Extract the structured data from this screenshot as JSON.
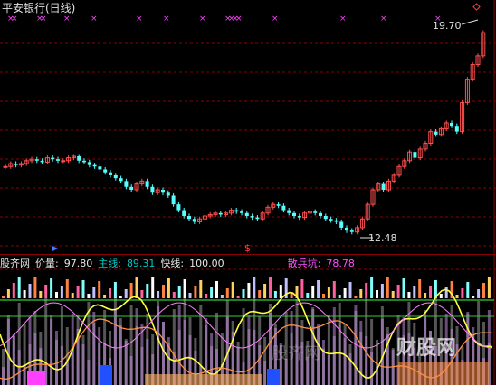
{
  "chart_title": "平安银行(日线)",
  "price_high_label": "19.70",
  "price_low_label": "12.48",
  "indicator": {
    "name": "股齐网",
    "price_label": "价量:",
    "price_value": "97.80",
    "main_label": "主线:",
    "main_value": "89.31",
    "fast_label": "快线:",
    "fast_value": "100.00",
    "scatter_label": "散兵坑:",
    "scatter_value": "78.78"
  },
  "marker_dollar": "$",
  "watermark": "股齐网",
  "watermark_logo": "财股网",
  "colors": {
    "up": "#ff5050",
    "down": "#54ffff",
    "grid": "#8a0000",
    "marker": "#ff40ff",
    "main_line": "#ffff40",
    "fast_line": "#ff9040",
    "green_line": "#40ff40"
  },
  "chart_data": {
    "type": "candlestick",
    "title": "平安银行(日线)",
    "max_marked": 19.7,
    "min_marked": 12.48,
    "closes": [
      14.8,
      14.9,
      14.85,
      14.9,
      15.0,
      15.05,
      15.0,
      14.95,
      15.1,
      15.05,
      15.0,
      15.0,
      15.1,
      15.15,
      15.0,
      14.95,
      14.85,
      14.8,
      14.7,
      14.6,
      14.5,
      14.4,
      14.3,
      14.1,
      14.0,
      14.2,
      14.3,
      14.1,
      13.9,
      14.0,
      13.9,
      13.8,
      13.5,
      13.3,
      13.1,
      13.0,
      12.9,
      13.0,
      13.1,
      13.15,
      13.2,
      13.15,
      13.2,
      13.3,
      13.25,
      13.2,
      13.1,
      13.05,
      13.0,
      13.2,
      13.4,
      13.5,
      13.45,
      13.3,
      13.2,
      13.1,
      13.05,
      13.2,
      13.25,
      13.2,
      13.1,
      13.0,
      12.95,
      12.9,
      12.7,
      12.6,
      12.55,
      12.7,
      13.0,
      13.5,
      14.0,
      14.2,
      14.0,
      14.3,
      14.5,
      14.8,
      15.0,
      15.3,
      15.1,
      15.4,
      15.6,
      16.0,
      15.9,
      16.1,
      16.3,
      16.2,
      16.0,
      17.0,
      17.8,
      18.3,
      18.6,
      19.4
    ],
    "indicator_values": {
      "价量": 97.8,
      "主线": 89.31,
      "快线": 100.0,
      "散兵坑": 78.78
    }
  }
}
